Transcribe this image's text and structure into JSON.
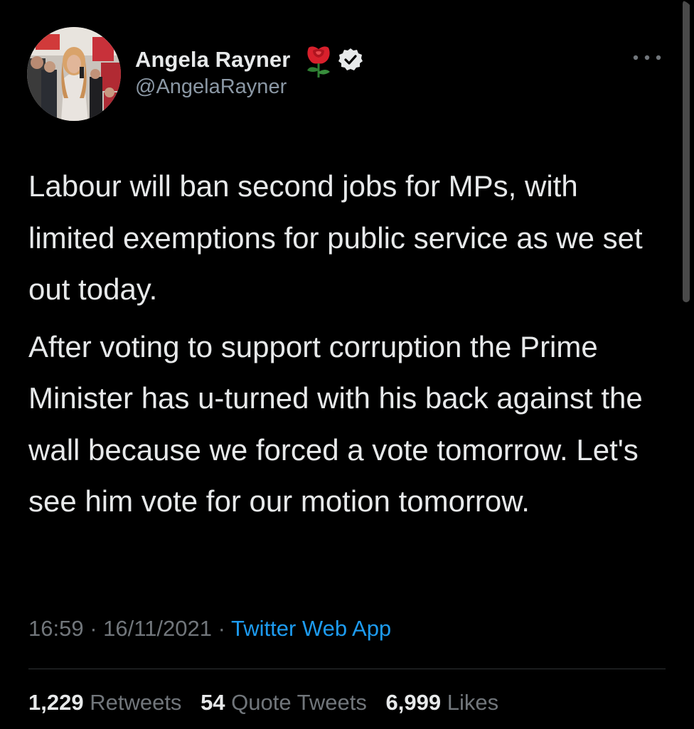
{
  "tweet": {
    "author": {
      "display_name": "Angela Rayner",
      "handle": "@AngelaRayner",
      "badges": [
        "rose-icon",
        "verified-icon"
      ]
    },
    "more_icon": "more-horizontal-icon",
    "paragraphs": [
      "Labour will ban second jobs for MPs, with limited exemptions for public service as we set out today.",
      "After voting to support corruption the Prime Minister has u-turned with his back against the wall because we forced a vote tomorrow. Let's see him vote for our motion tomorrow."
    ],
    "time": "16:59",
    "date": "16/11/2021",
    "separator": "·",
    "source": "Twitter Web App",
    "stats": {
      "retweets_count": "1,229",
      "retweets_label": "Retweets",
      "quotes_count": "54",
      "quotes_label": "Quote Tweets",
      "likes_count": "6,999",
      "likes_label": "Likes"
    }
  },
  "colors": {
    "background": "#000000",
    "text_primary": "#e7e9ea",
    "text_secondary": "#71767b",
    "link": "#1d9bf0",
    "rose_red": "#d8202c",
    "divider": "#2f3336"
  }
}
